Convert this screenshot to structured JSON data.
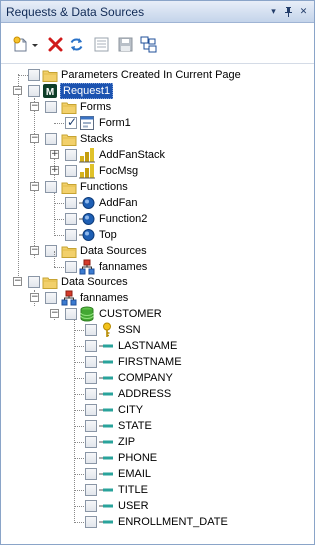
{
  "window": {
    "title": "Requests & Data Sources",
    "buttons": {
      "menu": "▾",
      "pin": "ᵖ",
      "close": "✕"
    }
  },
  "toolbar": {
    "tools": [
      {
        "name": "new-item-icon"
      },
      {
        "name": "dropdown-arrow-icon"
      },
      {
        "name": "delete-icon"
      },
      {
        "name": "refresh-icon"
      },
      {
        "name": "properties-icon"
      },
      {
        "name": "save-icon"
      },
      {
        "name": "structure-icon"
      }
    ]
  },
  "tree": {
    "parameters": "Parameters Created In Current Page",
    "request": "Request1",
    "forms": "Forms",
    "form1": "Form1",
    "stacks": "Stacks",
    "stack_items": [
      "AddFanStack",
      "FocMsg"
    ],
    "functions": "Functions",
    "function_items": [
      "AddFan",
      "Function2",
      "Top"
    ],
    "req_data_sources": "Data Sources",
    "req_ds_item": "fannames",
    "data_sources": "Data Sources",
    "ds_item": "fannames",
    "segment": "CUSTOMER",
    "fields": [
      "SSN",
      "LASTNAME",
      "FIRSTNAME",
      "COMPANY",
      "ADDRESS",
      "CITY",
      "STATE",
      "ZIP",
      "PHONE",
      "EMAIL",
      "TITLE",
      "USER",
      "ENROLLMENT_DATE"
    ]
  }
}
